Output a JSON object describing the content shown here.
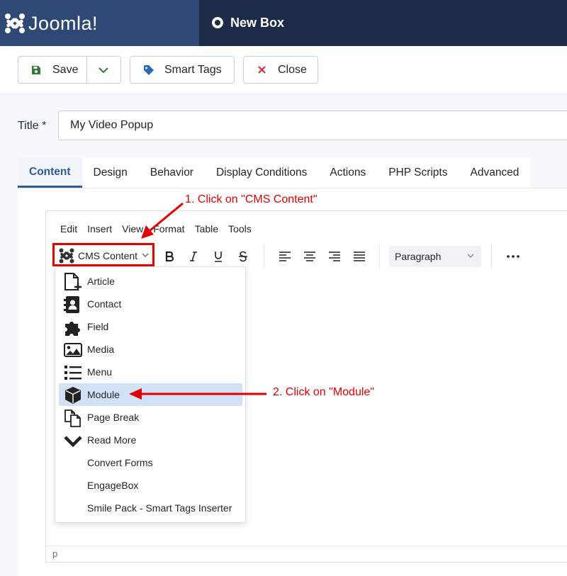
{
  "header": {
    "brand_text": "Joomla!",
    "page_title": "New Box"
  },
  "toolbar": {
    "save_label": "Save",
    "smart_tags_label": "Smart Tags",
    "close_label": "Close"
  },
  "form": {
    "title_label": "Title *",
    "title_value": "My Video Popup"
  },
  "tabs": [
    {
      "label": "Content"
    },
    {
      "label": "Design"
    },
    {
      "label": "Behavior"
    },
    {
      "label": "Display Conditions"
    },
    {
      "label": "Actions"
    },
    {
      "label": "PHP Scripts"
    },
    {
      "label": "Advanced"
    }
  ],
  "editor": {
    "menu": [
      "Edit",
      "Insert",
      "View",
      "Format",
      "Table",
      "Tools"
    ],
    "cms_content_label": "CMS Content",
    "paragraph_label": "Paragraph",
    "status_path": "p"
  },
  "dropdown": {
    "items": [
      {
        "label": "Article",
        "icon": "add-document-icon"
      },
      {
        "label": "Contact",
        "icon": "contact-card-icon"
      },
      {
        "label": "Field",
        "icon": "puzzle-piece-icon"
      },
      {
        "label": "Media",
        "icon": "image-icon"
      },
      {
        "label": "Menu",
        "icon": "list-icon"
      },
      {
        "label": "Module",
        "icon": "cube-icon"
      },
      {
        "label": "Page Break",
        "icon": "copy-document-icon"
      },
      {
        "label": "Read More",
        "icon": "chevron-down-icon"
      },
      {
        "label": "Convert Forms",
        "icon": ""
      },
      {
        "label": "EngageBox",
        "icon": ""
      },
      {
        "label": "Smile Pack - Smart Tags Inserter",
        "icon": ""
      }
    ],
    "active_item": "Module"
  },
  "annotations": {
    "step1": "1. Click on \"CMS Content\"",
    "step2": "2. Click on \"Module\""
  },
  "colors": {
    "header_bg": "#1c2b47",
    "brand_bg": "#2f4977",
    "active_tab": "#2f5a9c",
    "annotation_red": "#e00000",
    "save_icon": "#2e7d32",
    "tag_icon": "#2a69b8",
    "close_icon": "#d32f2f",
    "dropdown_active": "#d2e2f6"
  }
}
